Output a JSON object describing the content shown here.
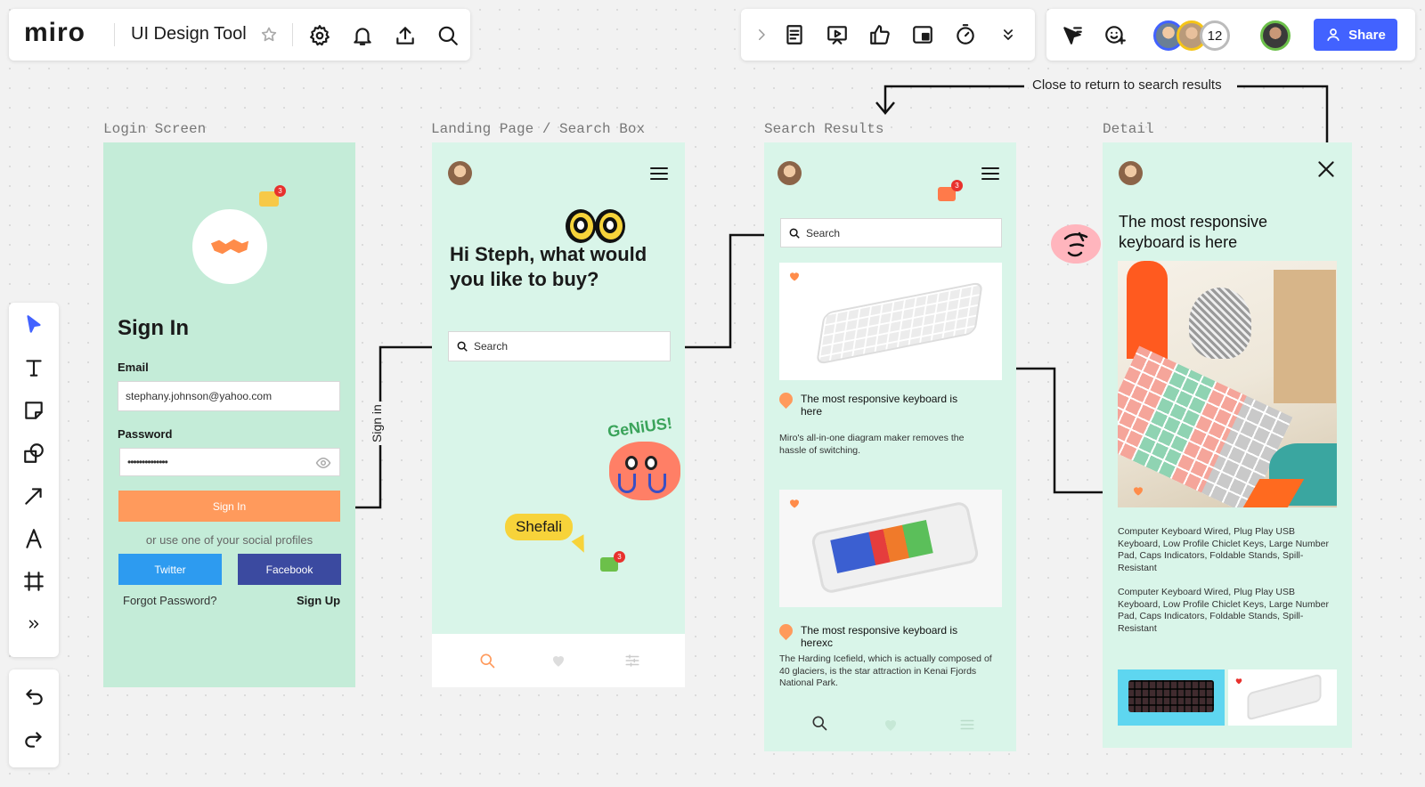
{
  "top_left": {
    "logo": "miro",
    "board_title": "UI Design Tool"
  },
  "top_right": {
    "avatar_count": "12",
    "share_label": "Share"
  },
  "flow_note": "Close to return to search results",
  "frames": {
    "login": {
      "label": "Login Screen"
    },
    "landing": {
      "label": "Landing Page / Search Box"
    },
    "results": {
      "label": "Search Results"
    },
    "detail": {
      "label": "Detail"
    }
  },
  "login": {
    "badge": "3",
    "title": "Sign In",
    "email_label": "Email",
    "email_value": "stephany.johnson@yahoo.com",
    "password_label": "Password",
    "password_value": "••••••••••••••",
    "signin_button": "Sign In",
    "social_text": "or use one of your social profiles",
    "twitter": "Twitter",
    "facebook": "Facebook",
    "forgot": "Forgot Password?",
    "signup": "Sign Up"
  },
  "connector_label": "Sign in",
  "landing": {
    "greeting": "Hi Steph, what would you like to buy?",
    "search_placeholder": "Search",
    "sticker_text": "GeNiUS!",
    "cursor_name": "Shefali",
    "badge": "3"
  },
  "results": {
    "badge": "3",
    "search_placeholder": "Search",
    "item1_title": "The most responsive keyboard is here",
    "item1_desc": "Miro's all-in-one diagram maker removes the hassle of switching.",
    "item2_title": "The most responsive keyboard is herexc",
    "item2_desc": "The Harding Icefield, which is actually composed of 40 glaciers, is the star attraction in Kenai Fjords National Park."
  },
  "detail": {
    "title": "The most responsive keyboard is here",
    "desc1": "Computer Keyboard Wired, Plug Play USB Keyboard, Low Profile Chiclet Keys, Large Number Pad, Caps Indicators, Foldable Stands, Spill-Resistant",
    "desc2": "Computer Keyboard Wired, Plug Play USB Keyboard, Low Profile Chiclet Keys, Large Number Pad, Caps Indicators, Foldable Stands, Spill-Resistant"
  },
  "colors": {
    "accent": "#4262ff",
    "mint": "#c4ecd8",
    "mint_light": "#d9f5e9",
    "orange": "#ff9a5c",
    "twitter": "#2d9bf0",
    "facebook": "#3b4aa0",
    "badge": "#e8312d"
  }
}
